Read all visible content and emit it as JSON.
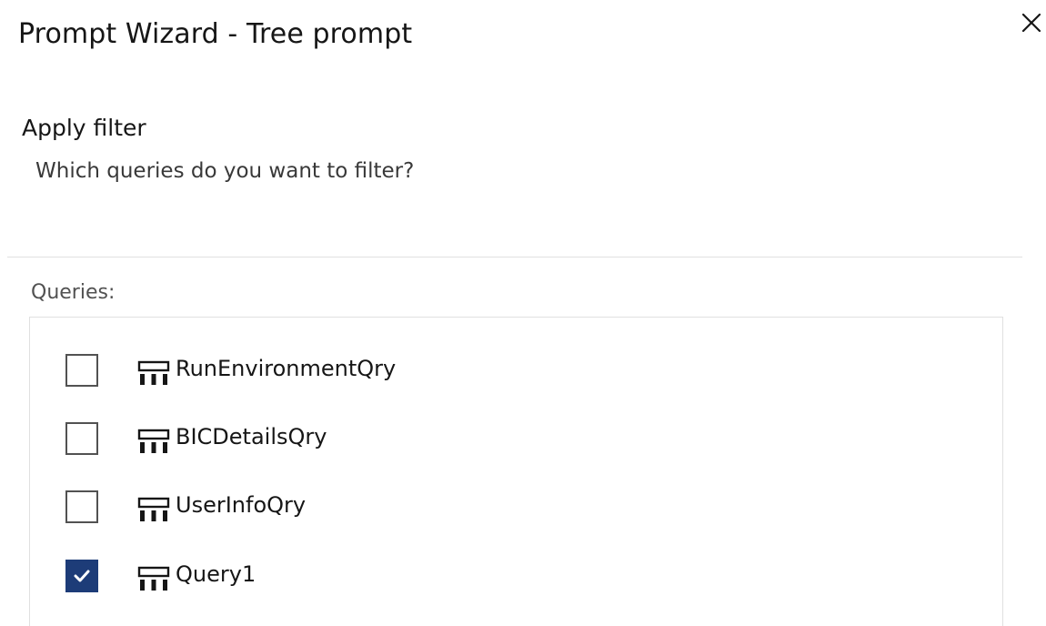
{
  "dialog": {
    "title": "Prompt Wizard - Tree prompt",
    "close_icon": "close-icon"
  },
  "step": {
    "heading": "Apply filter",
    "description": "Which queries do you want to filter?"
  },
  "queries": {
    "label": "Queries:",
    "item_icon": "query-icon",
    "checked_color": "#1d3c78",
    "items": [
      {
        "name": "RunEnvironmentQry",
        "checked": false
      },
      {
        "name": "BICDetailsQry",
        "checked": false
      },
      {
        "name": "UserInfoQry",
        "checked": false
      },
      {
        "name": "Query1",
        "checked": true
      }
    ]
  }
}
